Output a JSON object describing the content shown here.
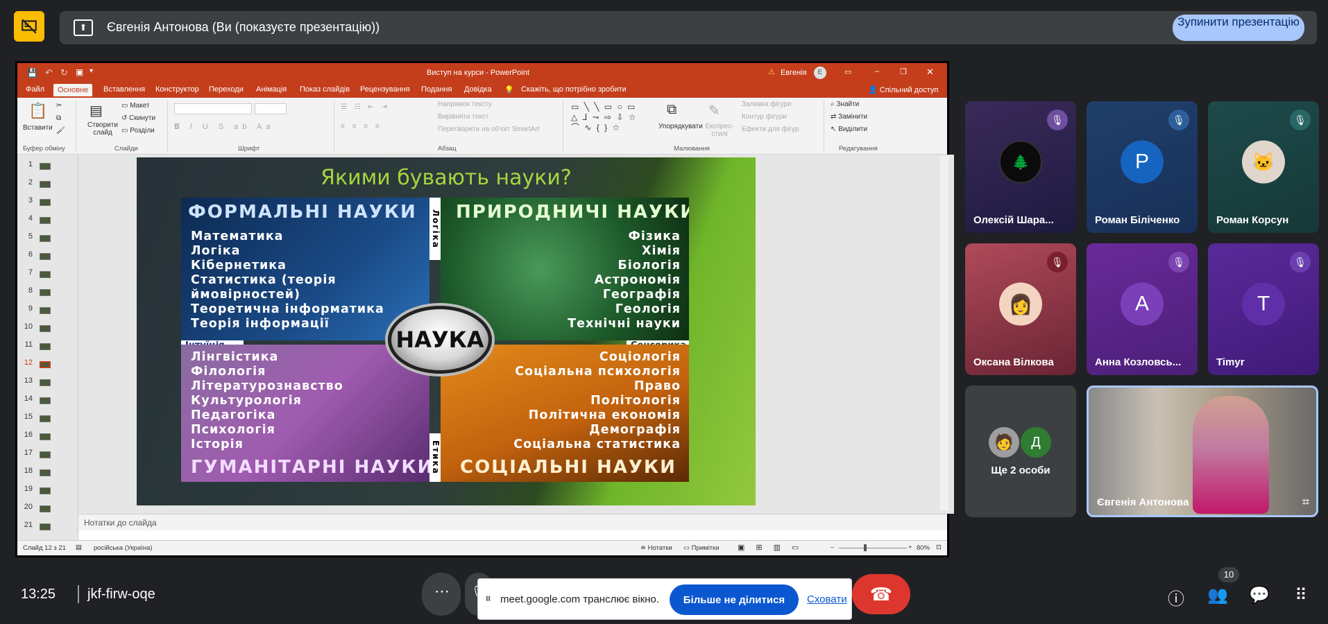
{
  "meet": {
    "banner_text": "Євгенія Антонова (Ви (показуєте презентацію))",
    "stop_presenting": "Зупинити презентацію",
    "time": "13:25",
    "meeting_code": "jkf-firw-oqe",
    "share_notice": "meet.google.com транслює вікно.",
    "stop_sharing": "Більше не ділитися",
    "hide": "Сховати",
    "people_count": "10"
  },
  "participants": [
    {
      "name": "Олексій Шара...",
      "avatar": "photo",
      "muted": true
    },
    {
      "name": "Роман Біліченко",
      "avatar": "P",
      "muted": true
    },
    {
      "name": "Роман Корсун",
      "avatar": "photo",
      "muted": true
    },
    {
      "name": "Оксана Вілкова",
      "avatar": "photo",
      "muted": true
    },
    {
      "name": "Анна Козловсь...",
      "avatar": "A",
      "muted": true
    },
    {
      "name": "Timyr",
      "avatar": "T",
      "muted": true
    },
    {
      "name": "Ще 2 особи",
      "avatar_letter": "Д"
    },
    {
      "name": "Євгенія Антонова",
      "video": true
    }
  ],
  "ppt": {
    "window_title": "Виступ на курси - PowerPoint",
    "user": "Евгенія",
    "user_initial": "E",
    "tabs": [
      "Файл",
      "Основне",
      "Вставлення",
      "Конструктор",
      "Переходи",
      "Анімація",
      "Показ слайдів",
      "Рецензування",
      "Подання",
      "Довідка"
    ],
    "tell_me": "Скажіть, що потрібно зробити",
    "share": "Спільний доступ",
    "ribbon": {
      "paste": "Вставити",
      "new_slide": "Створити слайд",
      "layout": "Макет",
      "reset": "Скинути",
      "sections": "Розділи",
      "text_direction": "Напрямок тексту",
      "align_text": "Вирівняти текст",
      "convert_smartart": "Перетворити на об'єкт SmartArt",
      "arrange": "Упорядкувати",
      "quick_styles": "Експрес-стилі",
      "shape_fill": "Заливка фігури",
      "shape_outline": "Контур фігури",
      "shape_effects": "Ефекти для фігур",
      "find": "Знайти",
      "replace": "Замінити",
      "select": "Виділити",
      "groups": [
        "Буфер обміну",
        "Слайди",
        "Шрифт",
        "Абзац",
        "Малювання",
        "Редагування"
      ]
    },
    "slide_numbers": [
      "1",
      "2",
      "3",
      "4",
      "5",
      "6",
      "7",
      "8",
      "9",
      "10",
      "11",
      "12",
      "13",
      "14",
      "15",
      "16",
      "17",
      "18",
      "19",
      "20",
      "21"
    ],
    "selected_slide": "12",
    "notes_placeholder": "Нотатки до слайда",
    "status": {
      "slide_of": "Слайд 12 з 21",
      "language": "російська (Україна)",
      "notes": "Нотатки",
      "comments": "Примітки",
      "zoom": "80%"
    }
  },
  "slide": {
    "title": "Якими бувають науки?",
    "center": "НАУКА",
    "formal_title": "ФОРМАЛЬНІ НАУКИ",
    "formal_items": [
      "Математика",
      "Логіка",
      "Кібернетика",
      "Статистика (теорія",
      "ймовірностей)",
      "Теоретична інформатика",
      "Теорія інформації"
    ],
    "natural_title": "ПРИРОДНИЧІ НАУКИ",
    "natural_items": [
      "Фізика",
      "Хімія",
      "Біологія",
      "Астрономія",
      "Географія",
      "Геологія",
      "Технічні науки"
    ],
    "human_title": "ГУМАНІТАРНІ НАУКИ",
    "human_items": [
      "Лінгвістика",
      "Філологія",
      "Літературознавство",
      "Культурологія",
      "Педагогіка",
      "Психологія",
      "Історія"
    ],
    "social_title": "СОЦІАЛЬНІ НАУКИ",
    "social_items": [
      "Соціологія",
      "Соціальна психологія",
      "Право",
      "Політологія",
      "Політична економія",
      "Демографія",
      "Соціальна статистика"
    ],
    "label_logic": "Логіка",
    "label_intuition": "Інтуїція",
    "label_sensory": "Сенсорика",
    "label_ethics": "Етика"
  }
}
